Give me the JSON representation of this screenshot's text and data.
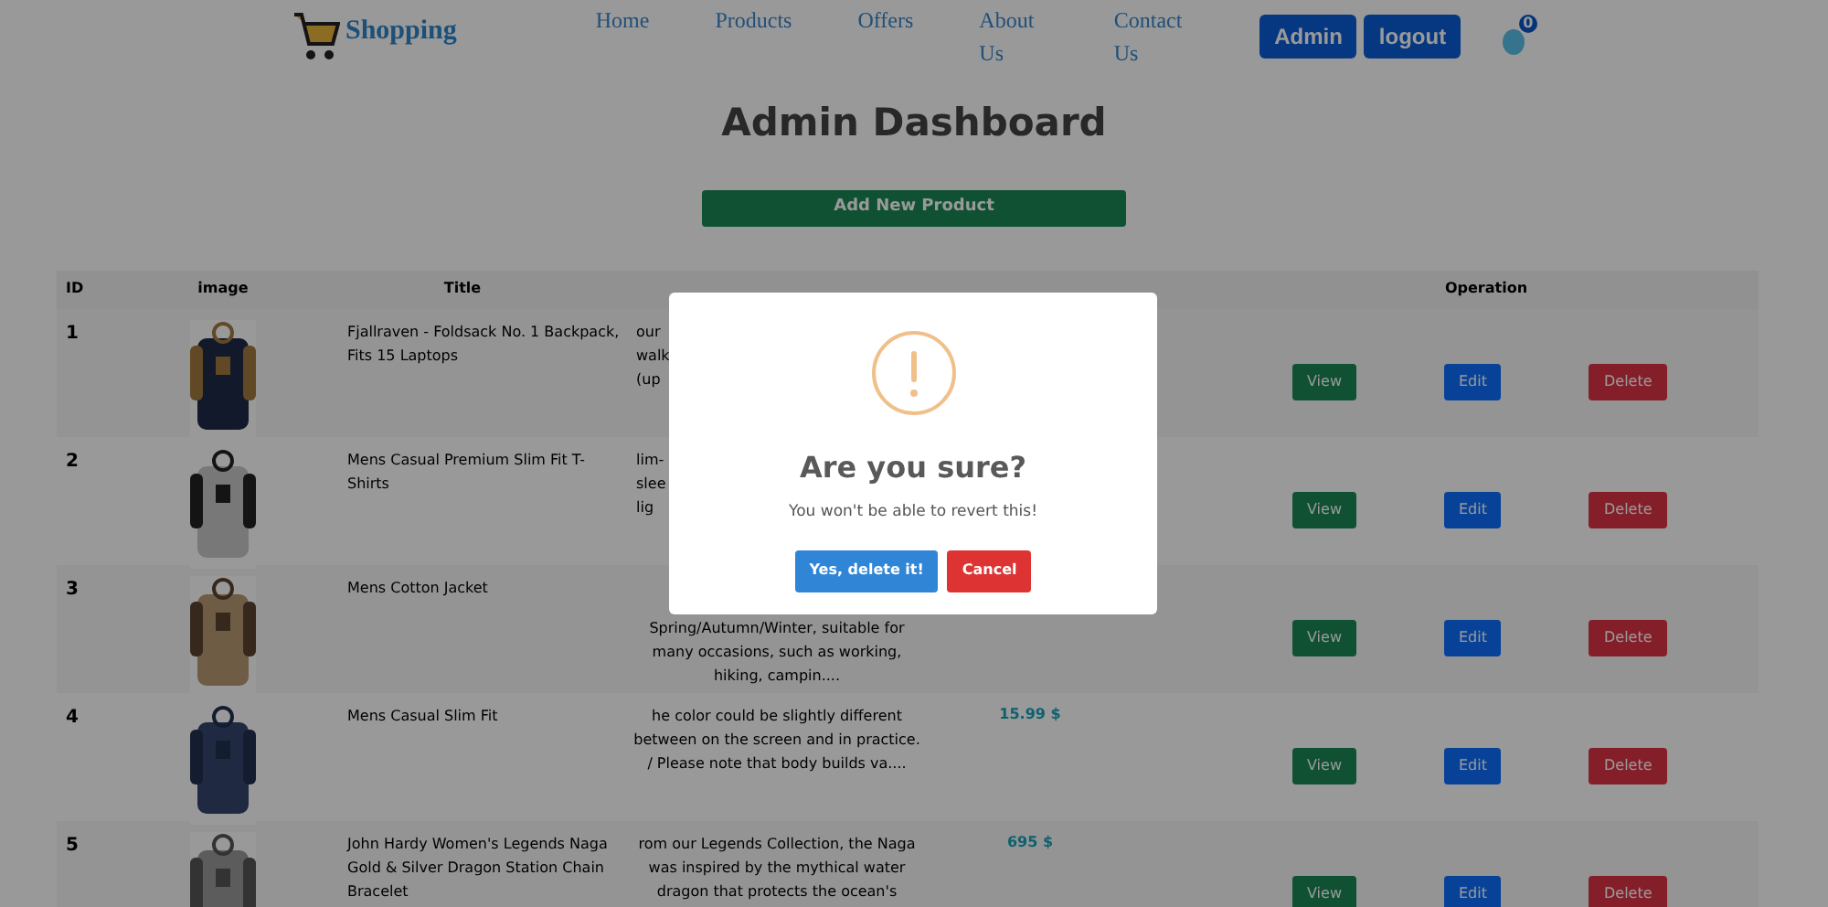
{
  "navbar": {
    "brand": "Shopping",
    "links": [
      "Home",
      "Products",
      "Offers",
      "About Us",
      "Contact Us"
    ],
    "buttons": [
      "Admin",
      "logout"
    ],
    "cart_count": "0"
  },
  "heading": "Admin Dashboard",
  "add_button": "Add New Product",
  "table": {
    "columns": [
      "ID",
      "image",
      "Title",
      "Operation"
    ],
    "rows": [
      {
        "id": "1",
        "image": {
          "kind": "picture"
        },
        "title": "Fjallraven - Foldsack No. 1 Backpack, Fits 15 Laptops",
        "description": {
          "kind": "clipped-right",
          "lines": [
            "our",
            "walk",
            "(up"
          ]
        },
        "price": "",
        "actions": [
          "View",
          "Edit",
          "Delete"
        ]
      },
      {
        "id": "2",
        "image": {
          "kind": "picture"
        },
        "title": "Mens Casual Premium Slim Fit T-Shirts",
        "description": {
          "kind": "clipped-right",
          "lines": [
            "lim-",
            "slee",
            "lig"
          ]
        },
        "price": "",
        "actions": [
          "View",
          "Edit",
          "Delete"
        ]
      },
      {
        "id": "3",
        "image": {
          "kind": "picture"
        },
        "title": "Mens Cotton Jacket",
        "description": {
          "kind": "clipped-top",
          "lines": [
            "Spring/Autumn/Winter, suitable for",
            "many occasions, such as working,",
            "hiking, campin...."
          ]
        },
        "price": "",
        "actions": [
          "View",
          "Edit",
          "Delete"
        ]
      },
      {
        "id": "4",
        "image": {
          "kind": "picture"
        },
        "title": "Mens Casual Slim Fit",
        "description": {
          "kind": "full",
          "lines": [
            "he color could be slightly different",
            "between on the screen and in practice.",
            "/ Please note that body builds va...."
          ]
        },
        "price": "15.99 $",
        "actions": [
          "View",
          "Edit",
          "Delete"
        ]
      },
      {
        "id": "5",
        "image": {
          "kind": "picture"
        },
        "title": "John Hardy Women's Legends Naga Gold & Silver Dragon Station Chain Bracelet",
        "description": {
          "kind": "full",
          "lines": [
            "rom our Legends Collection, the Naga",
            "was inspired by the mythical water",
            "dragon that protects the ocean's"
          ]
        },
        "price": "695 $",
        "actions": [
          "View",
          "Edit",
          "Delete"
        ]
      }
    ]
  },
  "dialog": {
    "title": "Are you sure?",
    "message": "You won't be able to revert this!",
    "confirm": "Yes, delete it!",
    "cancel": "Cancel"
  }
}
